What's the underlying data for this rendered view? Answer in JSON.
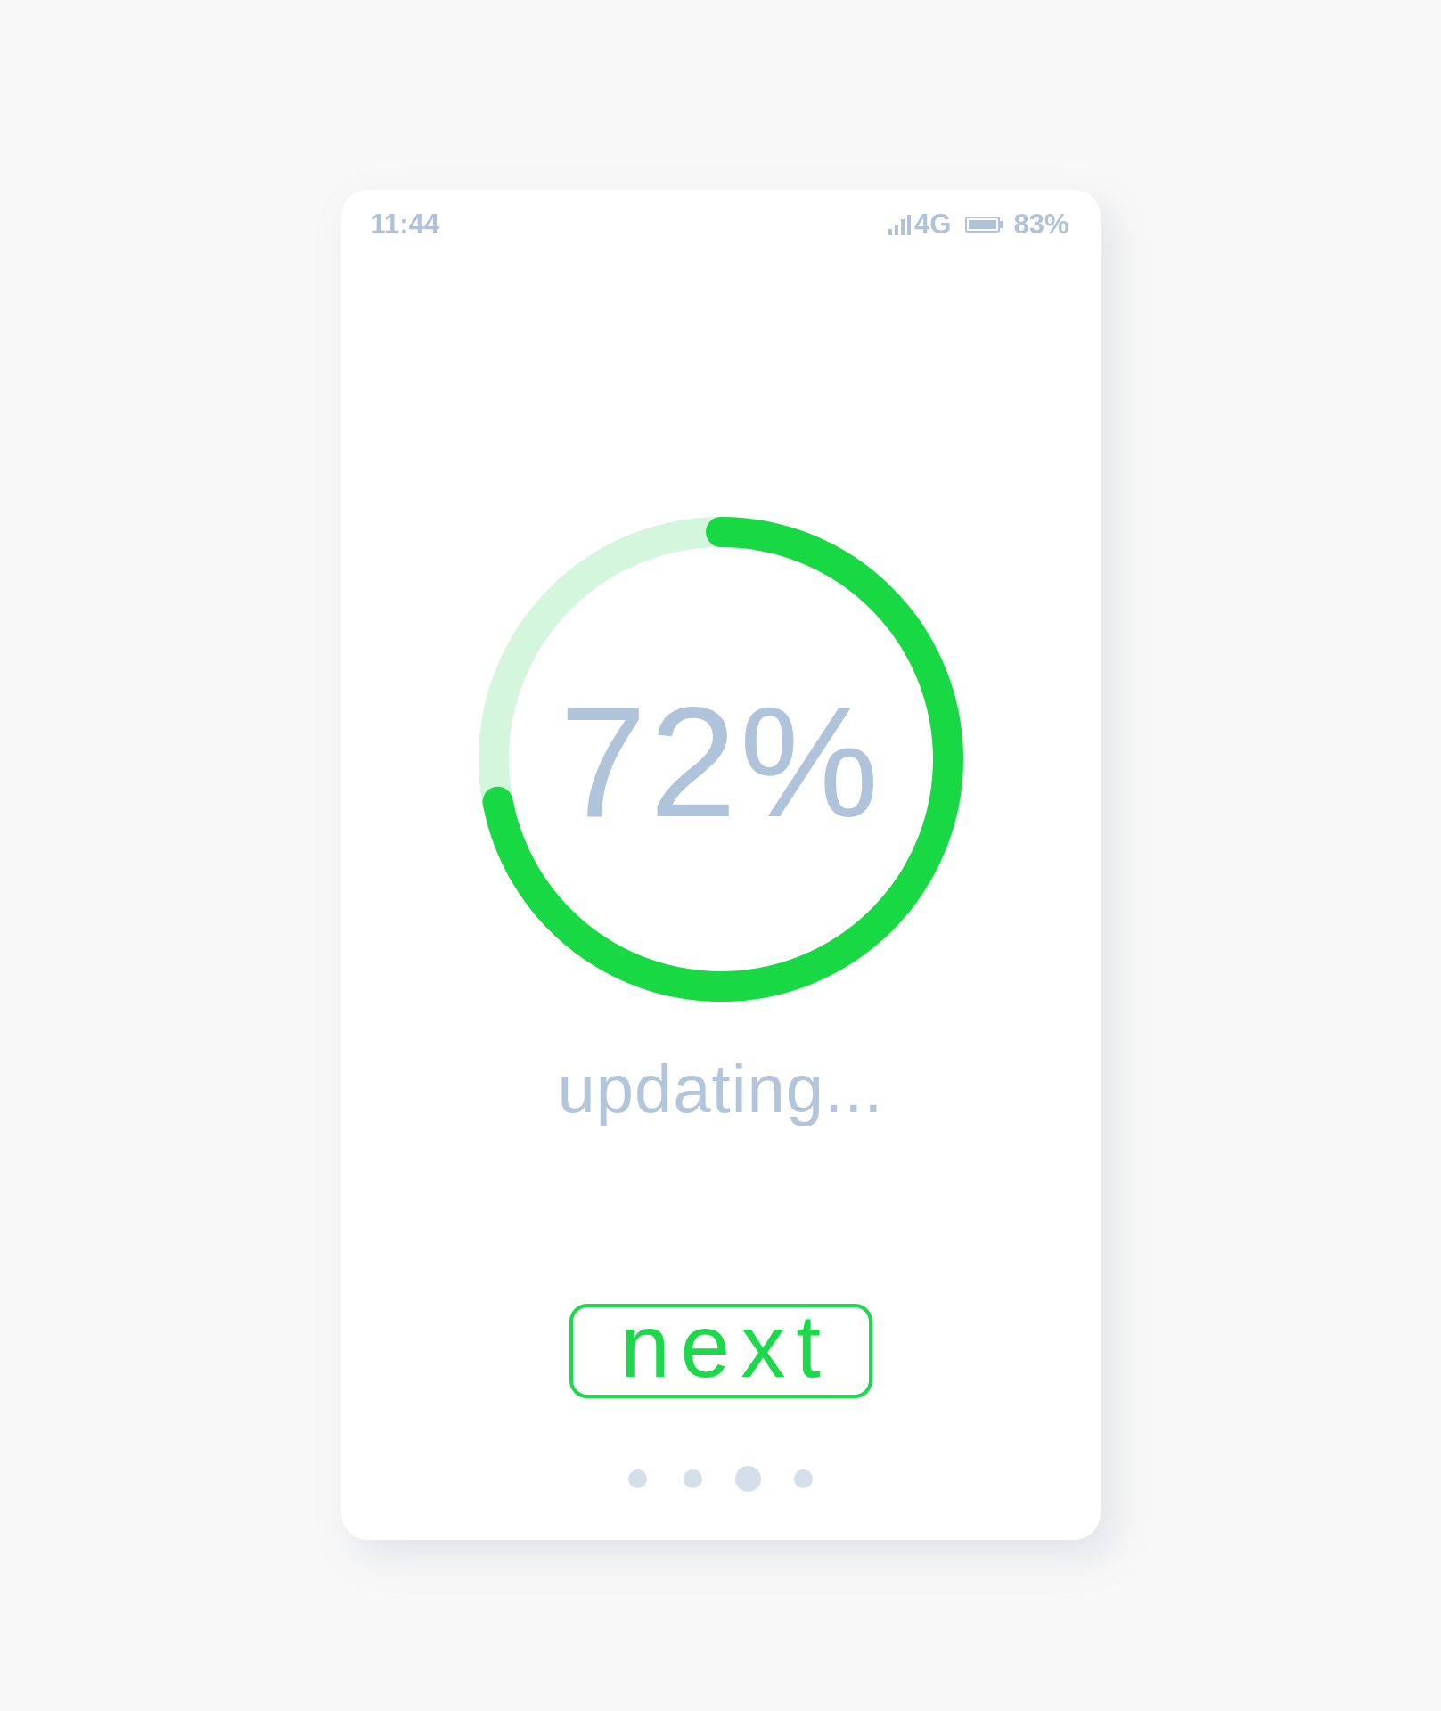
{
  "status_bar": {
    "time": "11:44",
    "network": "4G",
    "battery": "83%"
  },
  "progress": {
    "level": 0.72,
    "reading": "72%",
    "caption": "updating..."
  },
  "next_button": {
    "label": "next"
  },
  "page_dots": [
    {
      "selected": false
    },
    {
      "selected": false
    },
    {
      "selected": true
    },
    {
      "selected": false
    }
  ]
}
